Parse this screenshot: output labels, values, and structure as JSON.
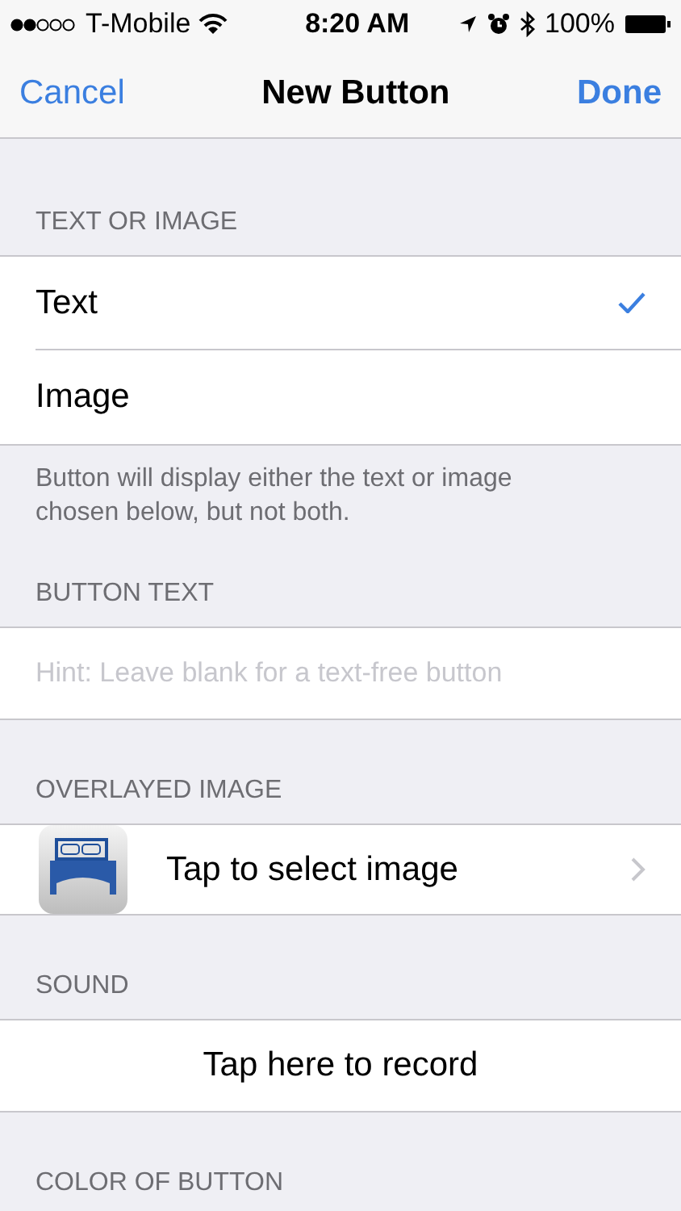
{
  "status_bar": {
    "carrier": "T-Mobile",
    "time": "8:20 AM",
    "battery": "100%"
  },
  "nav": {
    "cancel": "Cancel",
    "title": "New Button",
    "done": "Done"
  },
  "text_or_image": {
    "header": "TEXT OR IMAGE",
    "options": [
      {
        "label": "Text",
        "selected": true
      },
      {
        "label": "Image",
        "selected": false
      }
    ],
    "footer": "Button will display either the text or image chosen below, but not both."
  },
  "button_text": {
    "header": "BUTTON TEXT",
    "placeholder": "Hint: Leave blank for a text-free button"
  },
  "overlayed_image": {
    "header": "OVERLAYED IMAGE",
    "label": "Tap to select image"
  },
  "sound": {
    "header": "SOUND",
    "label": "Tap here to record"
  },
  "color_of_button": {
    "header": "COLOR OF BUTTON"
  }
}
